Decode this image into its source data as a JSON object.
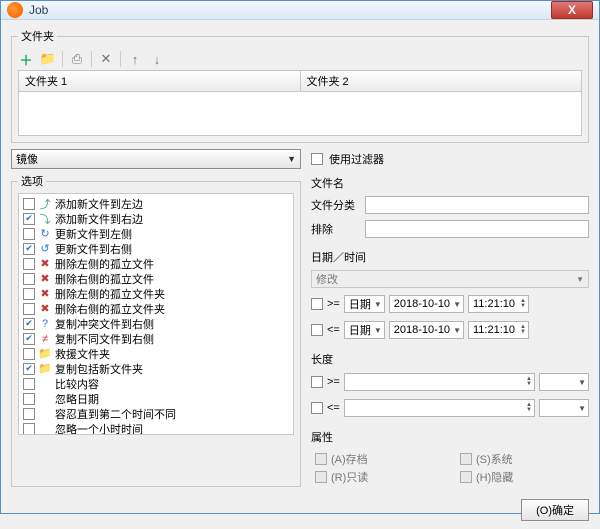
{
  "window": {
    "title": "Job",
    "close": "X"
  },
  "folders_group": {
    "legend": "文件夹",
    "columns": [
      "文件夹 1",
      "文件夹 2"
    ]
  },
  "mode_combo": "镜像",
  "options_legend": "选项",
  "options": [
    {
      "checked": false,
      "icon": "⤴",
      "color": "#29a366",
      "label": "添加新文件到左边"
    },
    {
      "checked": true,
      "icon": "⤵",
      "color": "#29a366",
      "label": "添加新文件到右边"
    },
    {
      "checked": false,
      "icon": "↻",
      "color": "#2a7fd4",
      "label": "更新文件到左侧"
    },
    {
      "checked": true,
      "icon": "↺",
      "color": "#2a7fd4",
      "label": "更新文件到右侧"
    },
    {
      "checked": false,
      "icon": "✖",
      "color": "#c23b3b",
      "label": "删除左侧的孤立文件"
    },
    {
      "checked": false,
      "icon": "✖",
      "color": "#c23b3b",
      "label": "删除右侧的孤立文件"
    },
    {
      "checked": false,
      "icon": "✖",
      "color": "#c23b3b",
      "label": "删除左侧的孤立文件夹"
    },
    {
      "checked": false,
      "icon": "✖",
      "color": "#c23b3b",
      "label": "删除右侧的孤立文件夹"
    },
    {
      "checked": true,
      "icon": "?",
      "color": "#2a7fd4",
      "label": "复制冲突文件到右侧"
    },
    {
      "checked": true,
      "icon": "≠",
      "color": "#c23b3b",
      "label": "复制不同文件到右侧"
    },
    {
      "checked": false,
      "icon": "📁",
      "color": "#e0a030",
      "label": "救援文件夹"
    },
    {
      "checked": true,
      "icon": "📁",
      "color": "#e0a030",
      "label": "复制包括新文件夹"
    },
    {
      "checked": false,
      "icon": "",
      "color": "",
      "label": "比较内容"
    },
    {
      "checked": false,
      "icon": "",
      "color": "",
      "label": "忽略日期"
    },
    {
      "checked": false,
      "icon": "",
      "color": "",
      "label": "容忍直到第二个时间不同"
    },
    {
      "checked": false,
      "icon": "",
      "color": "",
      "label": "忽略一个小时时间"
    }
  ],
  "filter": {
    "use_filter": "使用过滤器",
    "filename": "文件名",
    "category": "文件分类",
    "exclude": "排除"
  },
  "datetime": {
    "legend": "日期／时间",
    "mode": "修改",
    "gte": ">=",
    "lte": "<=",
    "type": "日期",
    "date": "2018-10-10",
    "time": "11:21:10"
  },
  "length": {
    "legend": "长度",
    "gte": ">=",
    "lte": "<="
  },
  "attributes": {
    "legend": "属性",
    "items": [
      "(A)存档",
      "(S)系统",
      "(R)只读",
      "(H)隐藏"
    ]
  },
  "footer": {
    "ok": "(O)确定"
  }
}
